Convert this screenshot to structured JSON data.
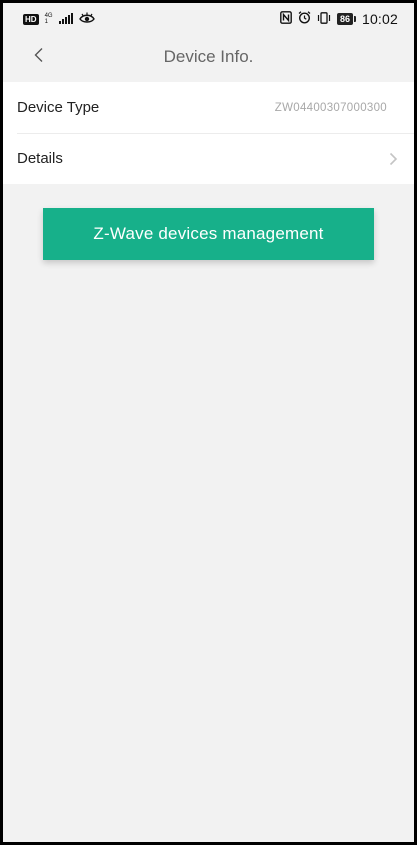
{
  "status_bar": {
    "hd": "HD",
    "network": "4G",
    "network_sub": "1",
    "battery": "86",
    "time": "10:02",
    "icons": [
      "signal-icon",
      "eye-icon",
      "nfc-icon",
      "alarm-icon",
      "vibrate-icon",
      "battery-icon"
    ]
  },
  "header": {
    "title": "Device Info.",
    "back_icon": "chevron-left-icon"
  },
  "list": {
    "items": [
      {
        "label": "Device Type",
        "value": "ZW04400307000300"
      },
      {
        "label": "Details",
        "icon": "chevron-right-icon"
      }
    ]
  },
  "actions": {
    "primary_label": "Z-Wave devices management",
    "primary_color": "#17b08a"
  }
}
